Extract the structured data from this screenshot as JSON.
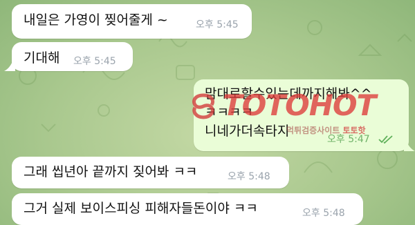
{
  "chat": {
    "messages": [
      {
        "direction": "in",
        "text": "내일은 가영이 찢어줄게 ~",
        "time": "오후 5:45"
      },
      {
        "direction": "in",
        "text": "기대해",
        "time": "오후 5:45"
      },
      {
        "direction": "out",
        "lines": [
          "맘대로할수있는데까지해봐^^",
          "ㅋㅋㅋㅋ",
          "니네가더속타지"
        ],
        "time": "오후 5:47",
        "status_icon": "double-check-icon"
      },
      {
        "direction": "in",
        "text": "그래 씹년아 끝까지 짖어봐 ㅋㅋ",
        "time": "오후 5:48"
      },
      {
        "direction": "in",
        "text": "그거 실제 보이스피싱 피해자들돈이야 ㅋㅋ",
        "time": "오후 5:48"
      }
    ]
  },
  "watermark": {
    "brand": "TOTOHOT",
    "sub_prefix": "먹튀검증사이트",
    "sub_brand": "토토핫"
  },
  "colors": {
    "incoming_bubble": "#ffffff",
    "outgoing_bubble": "#eafdd7",
    "outgoing_time": "#71b36a",
    "incoming_time": "#9aa3ac",
    "watermark_red": "#dc3a3a",
    "background": "#a9c88e"
  }
}
